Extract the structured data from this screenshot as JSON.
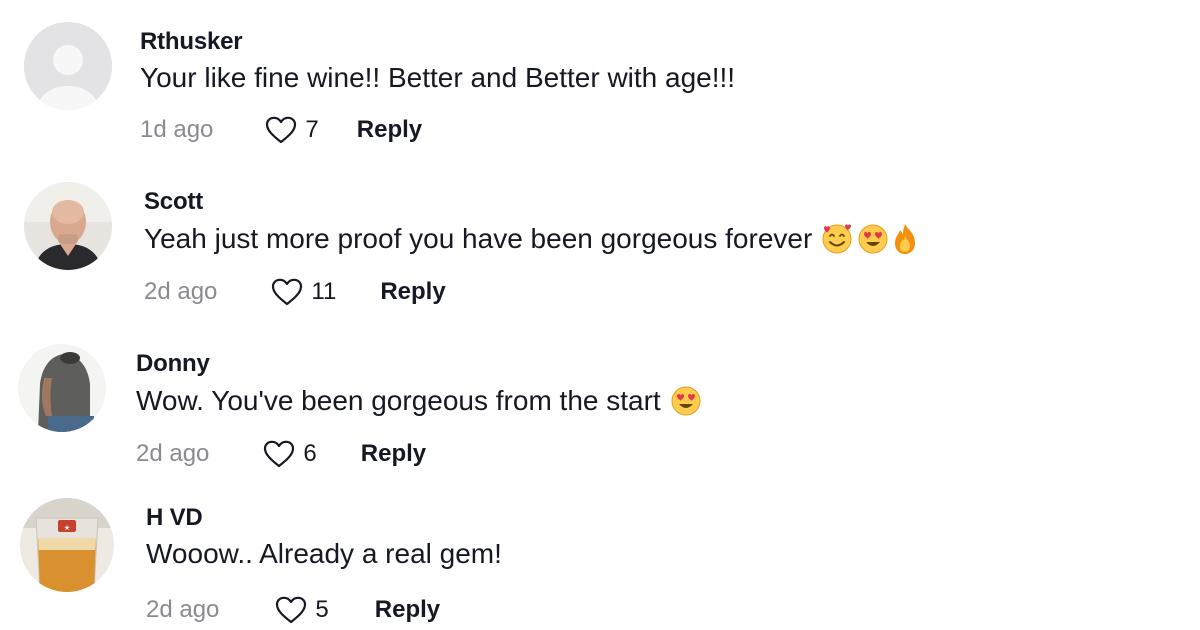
{
  "comments": [
    {
      "username": "Rthusker",
      "text": "Your like fine wine!! Better and Better with age!!!",
      "time": "1d ago",
      "likes": "7",
      "reply_label": "Reply",
      "avatar": "default-avatar",
      "emojis": []
    },
    {
      "username": "Scott",
      "text": "Yeah just more proof you have been gorgeous forever",
      "time": "2d ago",
      "likes": "11",
      "reply_label": "Reply",
      "avatar": "photo-man-headshot",
      "emojis": [
        "smiling-face-with-hearts",
        "heart-eyes",
        "fire"
      ]
    },
    {
      "username": "Donny",
      "text": "Wow. You've been gorgeous from the start",
      "time": "2d ago",
      "likes": "6",
      "reply_label": "Reply",
      "avatar": "photo-man-back",
      "emojis": [
        "heart-eyes"
      ]
    },
    {
      "username": "H VD",
      "text": "Wooow.. Already a real gem!",
      "time": "2d ago",
      "likes": "5",
      "reply_label": "Reply",
      "avatar": "photo-beer-glass",
      "emojis": []
    }
  ],
  "colors": {
    "text": "#161823",
    "muted": "#8a8b91",
    "background": "#ffffff"
  }
}
